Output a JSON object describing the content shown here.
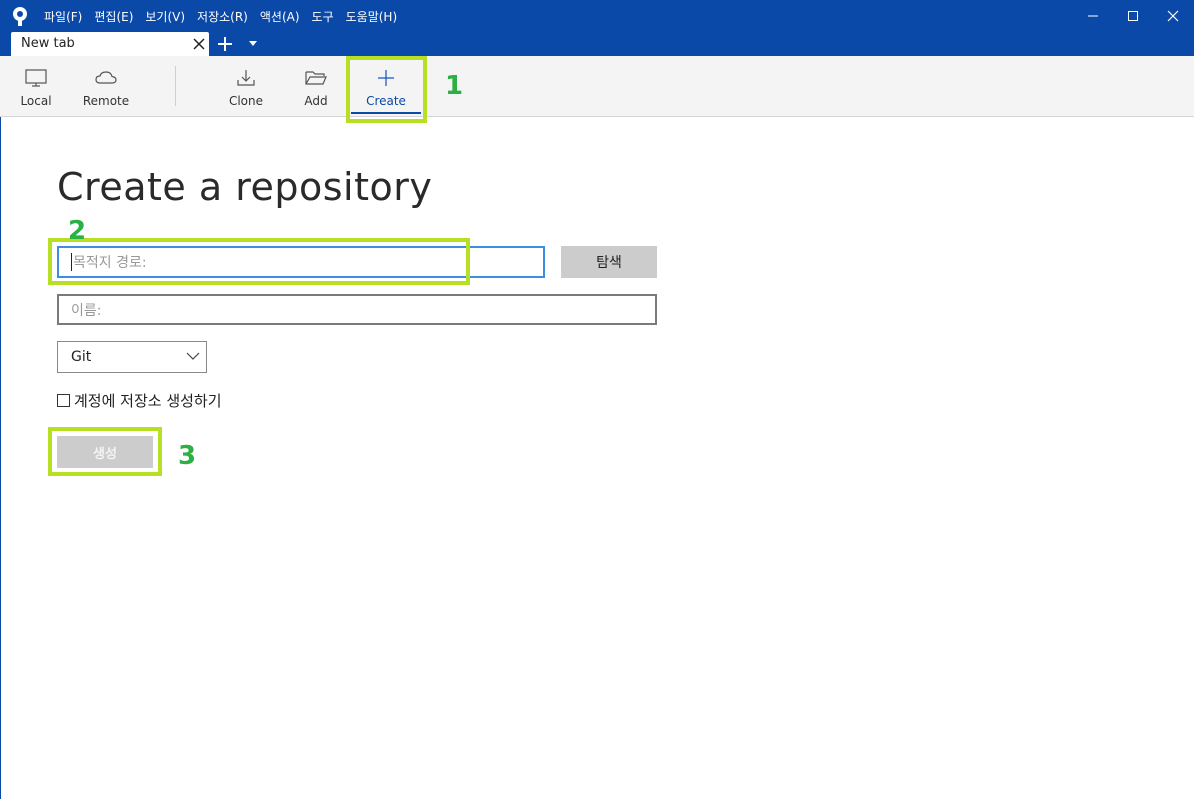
{
  "window": {
    "menu": [
      "파일(F)",
      "편집(E)",
      "보기(V)",
      "저장소(R)",
      "액션(A)",
      "도구",
      "도움말(H)"
    ]
  },
  "tabs": {
    "active_label": "New tab"
  },
  "toolbar": {
    "local": "Local",
    "remote": "Remote",
    "clone": "Clone",
    "add": "Add",
    "create": "Create"
  },
  "form": {
    "heading": "Create a repository",
    "path_placeholder": "목적지 경로:",
    "browse_label": "탐색",
    "name_placeholder": "이름:",
    "vcs_selected": "Git",
    "account_checkbox_label": "계정에 저장소 생성하기",
    "account_checkbox_checked": false,
    "create_label": "생성"
  },
  "annotations": {
    "step1": "1",
    "step2": "2",
    "step3": "3",
    "highlight_color": "#b7e025",
    "number_color": "#2ab043"
  },
  "colors": {
    "titlebar": "#0b49a8",
    "accent": "#0b49a8",
    "focus_border": "#3b8ee0"
  }
}
